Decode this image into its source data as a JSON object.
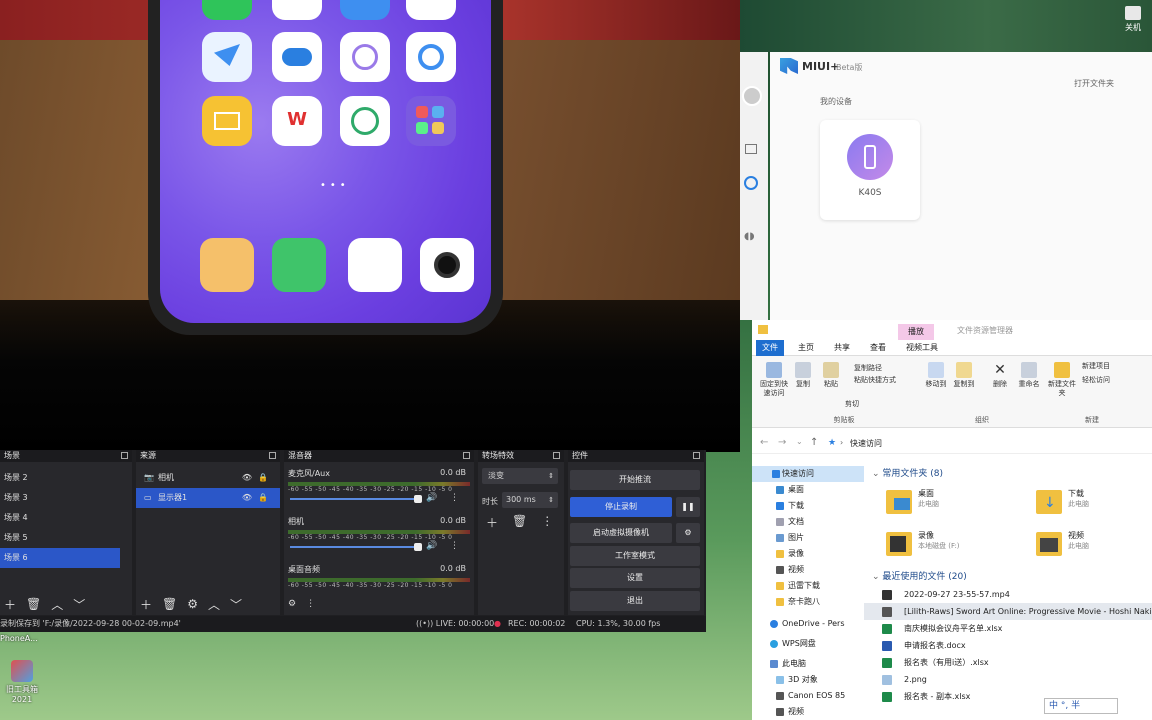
{
  "miui": {
    "title": "MIUI+",
    "badge": "Beta版",
    "open_folder": "打开文件夹",
    "my_devices": "我的设备",
    "device_name": "K40S"
  },
  "desktop": {
    "shutdown_label": "关机",
    "tool_label": "旧工具箱",
    "tool_year": "2021",
    "phone_label": "PhoneA..."
  },
  "obs": {
    "scenes_title": "场景",
    "scenes": [
      "场景 2",
      "场景 3",
      "场景 4",
      "场景 5",
      "场景 6"
    ],
    "sources_title": "来源",
    "sources": [
      "相机",
      "显示器1"
    ],
    "mixer_title": "混音器",
    "channels": [
      {
        "name": "麦克风/Aux",
        "db": "0.0 dB"
      },
      {
        "name": "相机",
        "db": "0.0 dB"
      },
      {
        "name": "桌面音频",
        "db": "0.0 dB"
      }
    ],
    "meter_scale": "-60 -55 -50 -45 -40 -35 -30 -25 -20 -15 -10 -5 0",
    "transitions_title": "转场特效",
    "transition_value": "淡变",
    "duration_label": "时长",
    "duration_value": "300 ms",
    "controls_title": "控件",
    "controls": {
      "start_stream": "开始推流",
      "stop_record": "停止录制",
      "virtual_cam": "启动虚拟摄像机",
      "studio_mode": "工作室模式",
      "settings": "设置",
      "exit": "退出"
    },
    "status": {
      "saved": "录制保存到 'F:/录像/2022-09-28 00-02-09.mp4'",
      "live": "LIVE: 00:00:00",
      "rec": "REC: 00:00:02",
      "cpu": "CPU: 1.3%, 30.00 fps"
    }
  },
  "explorer": {
    "ribbon_tabs": [
      "文件",
      "主页",
      "共享",
      "查看",
      "视频工具"
    ],
    "context_tab": "播放",
    "window_title": "文件资源管理器",
    "ribbon_buttons": {
      "pin": "固定到快速访问",
      "copy": "复制",
      "paste": "粘贴",
      "copy_path": "复制路径",
      "paste_shortcut": "粘贴快捷方式",
      "cut": "剪切",
      "move_to": "移动到",
      "copy_to": "复制到",
      "delete": "删除",
      "rename": "重命名",
      "new_folder": "新建文件夹",
      "new_item": "新建项目",
      "easy_access": "轻松访问"
    },
    "ribbon_groups": [
      "剪贴板",
      "组织",
      "新建"
    ],
    "address": "快速访问",
    "nav": [
      "快速访问",
      "桌面",
      "下载",
      "文档",
      "图片",
      "录像",
      "视频",
      "迅雷下载",
      "奈卡跑八",
      "OneDrive - Pers",
      "WPS网盘",
      "此电脑",
      "3D 对象",
      "Canon EOS 85",
      "视频"
    ],
    "frequent_header": "常用文件夹 (8)",
    "frequent": [
      {
        "name": "桌面",
        "loc": "此电脑"
      },
      {
        "name": "下载",
        "loc": "此电脑"
      },
      {
        "name": "录像",
        "loc": "本地磁盘 (F:)"
      },
      {
        "name": "视频",
        "loc": "此电脑"
      }
    ],
    "recent_header": "最近使用的文件 (20)",
    "recent": [
      "2022-09-27 23-55-57.mp4",
      "[Lilith-Raws] Sword Art Online: Progressive Movie - Hoshi Naki",
      "南庆模拟会议舟平名单.xlsx",
      "申请报名表.docx",
      "报名表（有用i送）.xlsx",
      "2.png",
      "报名表 - 副本.xlsx"
    ]
  },
  "ime": {
    "text": "中 °, 半"
  },
  "colors": {
    "obs_accent": "#2f5fd6",
    "miui_accent": "#6b5ce7",
    "explorer_accent": "#1e6ecf"
  }
}
